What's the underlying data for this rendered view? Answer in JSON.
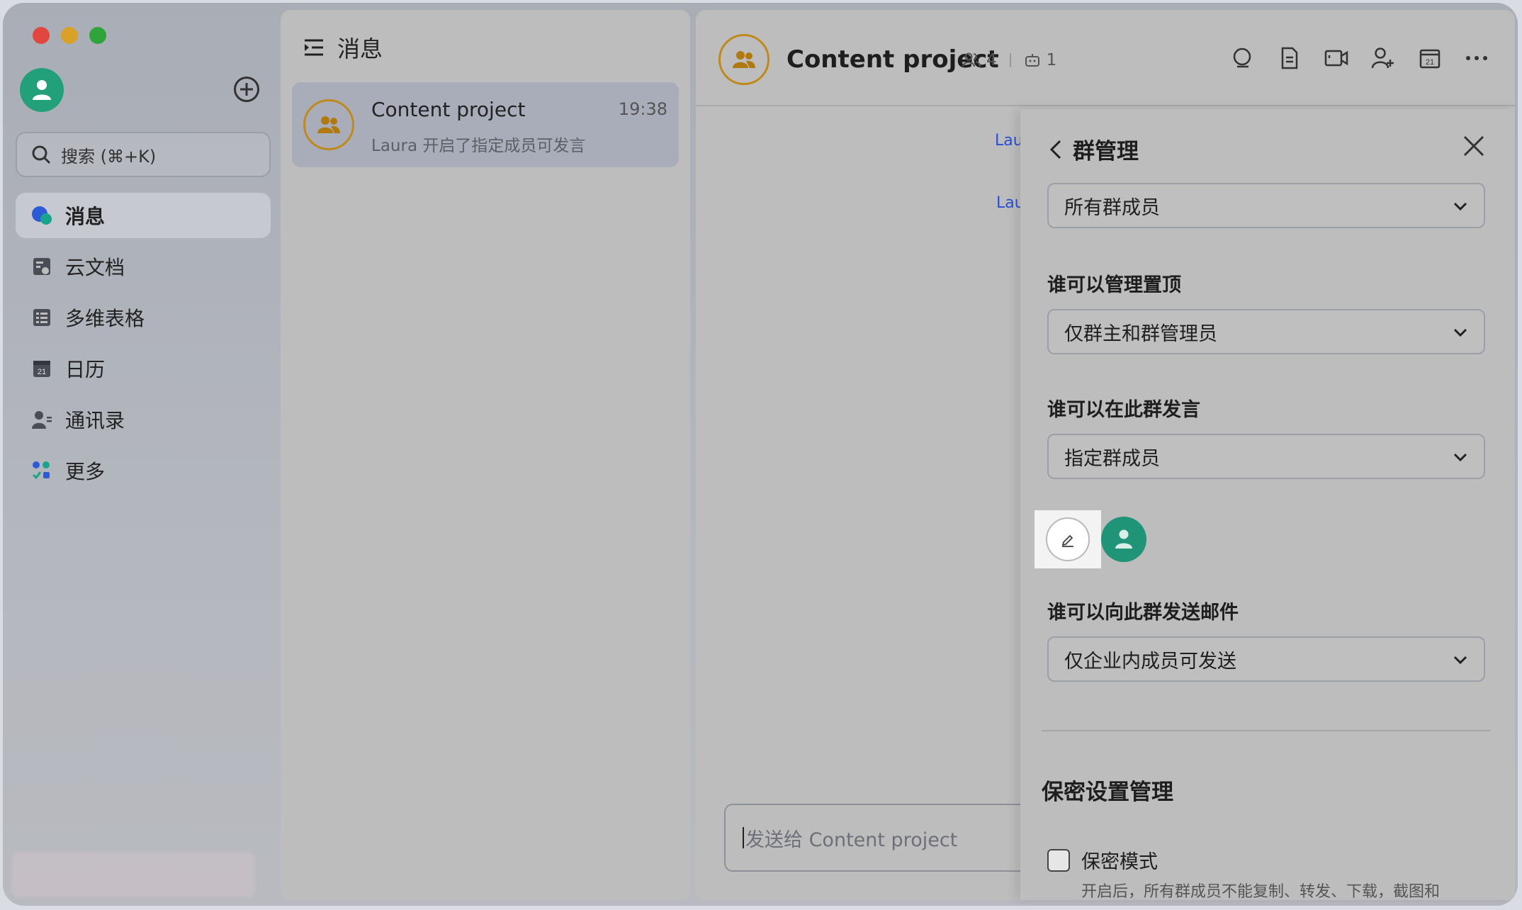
{
  "sidebar": {
    "search_placeholder": "搜索 (⌘+K)",
    "items": [
      {
        "label": "消息",
        "icon": "messages-icon",
        "active": true
      },
      {
        "label": "云文档",
        "icon": "docs-icon"
      },
      {
        "label": "多维表格",
        "icon": "base-icon"
      },
      {
        "label": "日历",
        "icon": "calendar-icon"
      },
      {
        "label": "通讯录",
        "icon": "contacts-icon"
      },
      {
        "label": "更多",
        "icon": "more-apps-icon"
      }
    ]
  },
  "chatlist": {
    "title": "消息",
    "items": [
      {
        "name": "Content project",
        "time": "19:38",
        "preview": "Laura 开启了指定成员可发言"
      }
    ]
  },
  "chat": {
    "title": "Content project",
    "member_count": "4",
    "bot_count": "1",
    "messages": [
      "Lau",
      "Lau"
    ],
    "composer_placeholder": "发送给 Content project",
    "tools": [
      "search-icon",
      "document-icon",
      "video-call-icon",
      "add-member-icon",
      "calendar-icon",
      "more-icon"
    ]
  },
  "panel": {
    "title": "群管理",
    "first_select": "所有群成员",
    "pin_label": "谁可以管理置顶",
    "pin_select": "仅群主和群管理员",
    "speak_label": "谁可以在此群发言",
    "speak_select": "指定群成员",
    "mail_label": "谁可以向此群发送邮件",
    "mail_select": "仅企业内成员可发送",
    "privacy_title": "保密设置管理",
    "privacy_checkbox": "保密模式",
    "privacy_desc": "开启后，所有群成员不能复制、转发、下载，截图和"
  },
  "colors": {
    "avatar_green": "#22a07a",
    "group_ring": "#c08a1a",
    "link_blue": "#2a4fd0"
  }
}
